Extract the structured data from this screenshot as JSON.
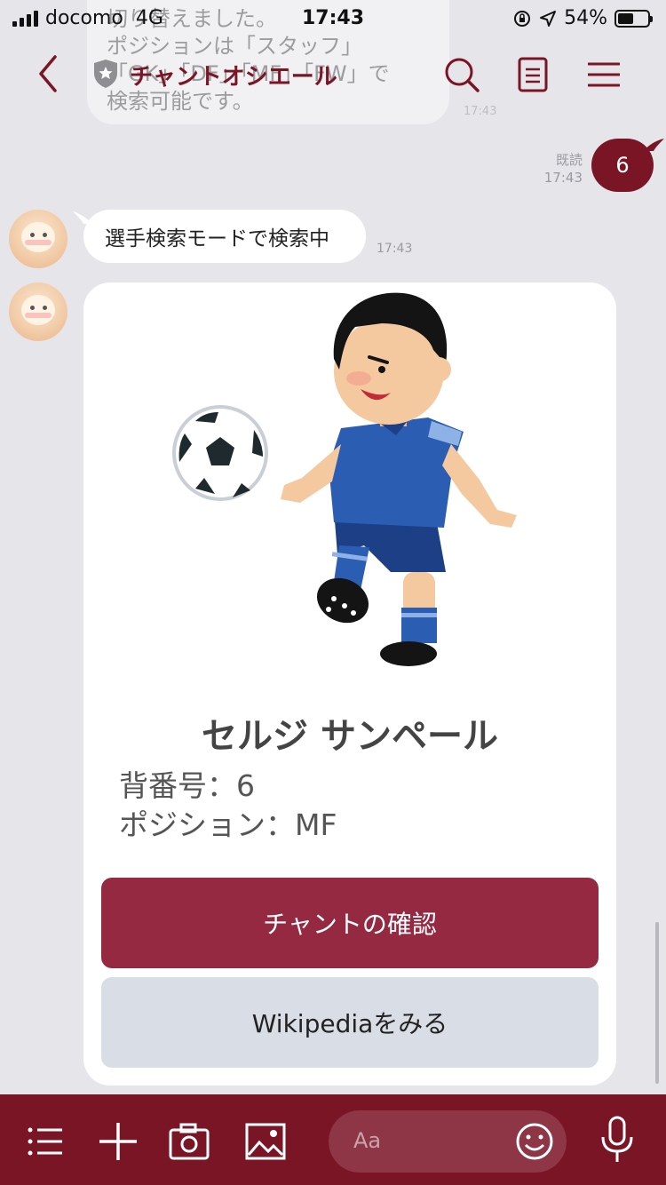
{
  "status_bar": {
    "carrier": "docomo",
    "network": "4G",
    "time": "17:43",
    "battery": "54%",
    "battery_level": 0.54
  },
  "previous_message": {
    "lines": [
      "切り替えました。",
      "ポジションは「スタッフ」",
      "「GK」「DF」「MF」「FW」で",
      "検索可能です。"
    ],
    "time": "17:43"
  },
  "header": {
    "title": "チャントオシエール"
  },
  "messages": {
    "user_read_label": "既読",
    "user_time": "17:43",
    "user_text": "6",
    "bot_text": "選手検索モードで検索中",
    "bot_time": "17:43"
  },
  "card": {
    "player_name": "セルジ サンペール",
    "number_line": "背番号：6",
    "position_line": "ポジション：MF",
    "primary_button": "チャントの確認",
    "secondary_button": "Wikipediaをみる"
  },
  "toolbar": {
    "input_placeholder": "Aa"
  },
  "colors": {
    "brand": "#7a1526",
    "primary_button": "#952941",
    "secondary_button": "#d9dde5",
    "chat_background": "#e6e5ea"
  }
}
